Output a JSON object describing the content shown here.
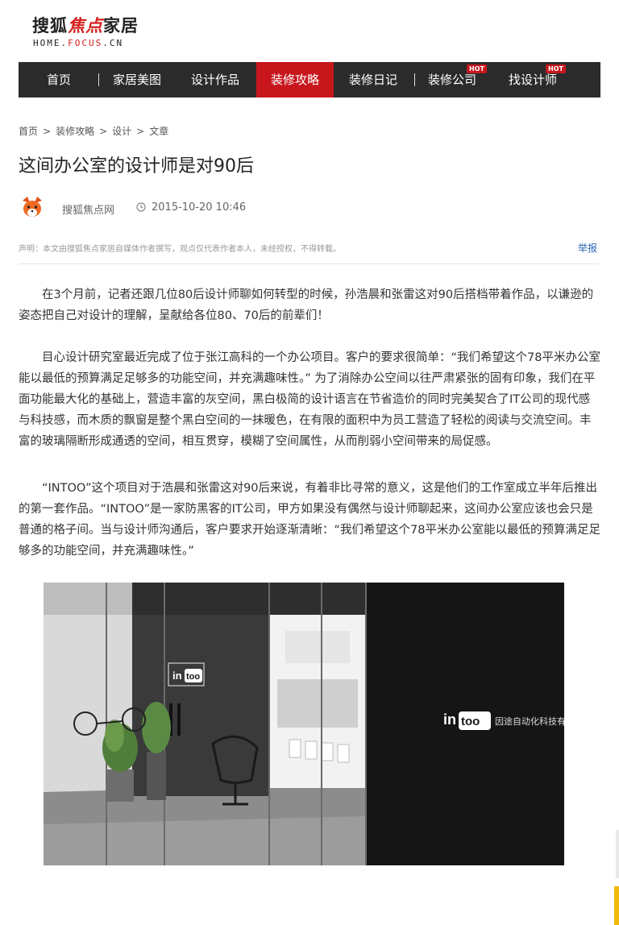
{
  "logo": {
    "brand_prefix": "搜狐",
    "brand_mark": "焦点",
    "brand_suffix": "家居",
    "domain_prefix": "HOME.",
    "domain_mid": "FOCUS",
    "domain_suffix": ".CN"
  },
  "nav": {
    "items": [
      {
        "label": "首页"
      },
      {
        "label": "家居美图"
      },
      {
        "label": "设计作品"
      },
      {
        "label": "装修攻略",
        "active": true
      },
      {
        "label": "装修日记"
      },
      {
        "label": "装修公司",
        "badge": "HOT"
      },
      {
        "label": "找设计师",
        "badge": "HOT"
      }
    ],
    "active_color": "#c8161d",
    "bg_color": "#2b2b2b"
  },
  "breadcrumb": [
    "首页",
    ">",
    "装修攻略",
    ">",
    "设计",
    ">",
    "文章"
  ],
  "article": {
    "title": "这间办公室的设计师是对90后",
    "author": "搜狐焦点网",
    "date": "2015-10-20 10:46",
    "disclaimer": "声明：本文由搜狐焦点家居自媒体作者撰写，观点仅代表作者本人，未经授权，不得转载。",
    "report_label": "举报",
    "paragraphs": [
      "在3个月前，记者还跟几位80后设计师聊如何转型的时候，孙浩晨和张雷这对90后搭档带着作品，以谦逊的姿态把自己对设计的理解，呈献给各位80、70后的前辈们！",
      "目心设计研究室最近完成了位于张江高科的一个办公项目。客户的要求很简单：“我们希望这个78平米办公室能以最低的预算满足足够多的功能空间，并充满趣味性。” 为了消除办公空间以往严肃紧张的固有印象，我们在平面功能最大化的基础上，营造丰富的灰空间，黑白极简的设计语言在节省造价的同时完美契合了IT公司的现代感与科技感，而木质的飘窗是整个黑白空间的一抹暖色，在有限的面积中为员工营造了轻松的阅读与交流空间。丰富的玻璃隔断形成通透的空间，相互贯穿，模糊了空间属性，从而削弱小空间带来的局促感。",
      "“INTOO”这个项目对于浩晨和张雷这对90后来说，有着非比寻常的意义，这是他们的工作室成立半年后推出的第一套作品。“INTOO”是一家防黑客的IT公司，甲方如果没有偶然与设计师聊起来，这间办公室应该也会只是普通的格子间。当与设计师沟通后，客户要求开始逐渐清晰：“我们希望这个78平米办公室能以最低的预算满足足够多的功能空间，并充满趣味性。”"
    ]
  },
  "photo": {
    "logo_in": "in",
    "logo_too": "too",
    "wall_text": "因途自动化科技有"
  },
  "colors": {
    "accent": "#c8161d",
    "link": "#2a66b4"
  }
}
